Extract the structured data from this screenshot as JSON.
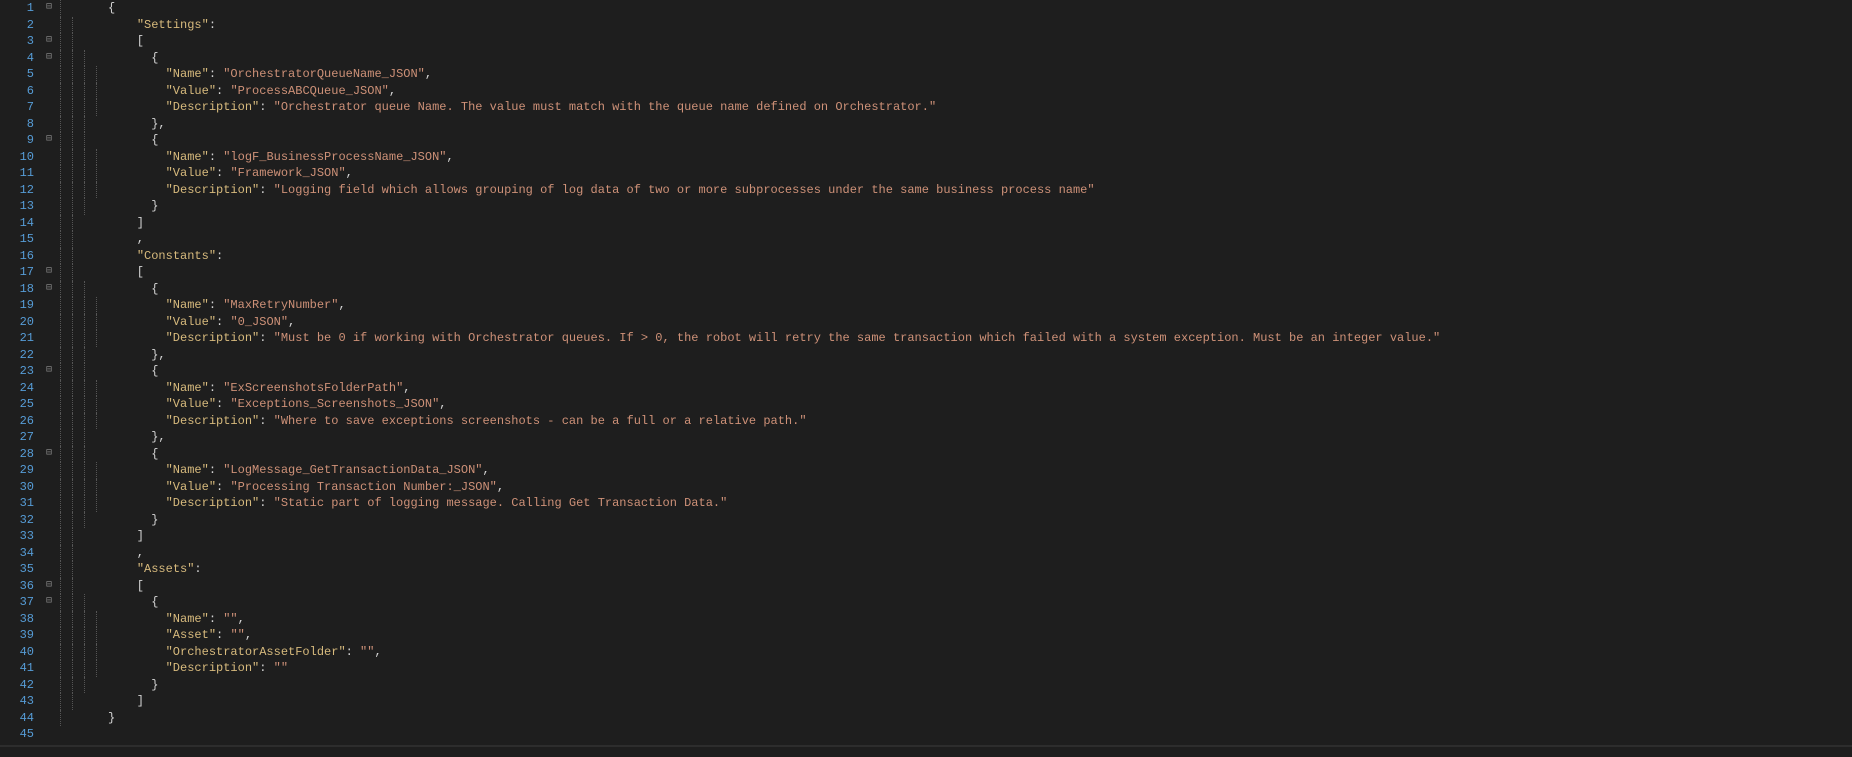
{
  "line_count": 45,
  "fold_markers": {
    "1": "⊟",
    "3": "⊟",
    "4": "⊟",
    "9": "⊟",
    "17": "⊟",
    "18": "⊟",
    "23": "⊟",
    "28": "⊟",
    "36": "⊟",
    "37": "⊟"
  },
  "indent_guides": {
    "1": [
      0
    ],
    "2": [
      0,
      1
    ],
    "3": [
      0,
      1
    ],
    "4": [
      0,
      1,
      2
    ],
    "5": [
      0,
      1,
      2,
      3
    ],
    "6": [
      0,
      1,
      2,
      3
    ],
    "7": [
      0,
      1,
      2,
      3
    ],
    "8": [
      0,
      1,
      2
    ],
    "9": [
      0,
      1,
      2
    ],
    "10": [
      0,
      1,
      2,
      3
    ],
    "11": [
      0,
      1,
      2,
      3
    ],
    "12": [
      0,
      1,
      2,
      3
    ],
    "13": [
      0,
      1,
      2
    ],
    "14": [
      0,
      1
    ],
    "15": [
      0,
      1
    ],
    "16": [
      0,
      1
    ],
    "17": [
      0,
      1
    ],
    "18": [
      0,
      1,
      2
    ],
    "19": [
      0,
      1,
      2,
      3
    ],
    "20": [
      0,
      1,
      2,
      3
    ],
    "21": [
      0,
      1,
      2,
      3
    ],
    "22": [
      0,
      1,
      2
    ],
    "23": [
      0,
      1,
      2
    ],
    "24": [
      0,
      1,
      2,
      3
    ],
    "25": [
      0,
      1,
      2,
      3
    ],
    "26": [
      0,
      1,
      2,
      3
    ],
    "27": [
      0,
      1,
      2
    ],
    "28": [
      0,
      1,
      2
    ],
    "29": [
      0,
      1,
      2,
      3
    ],
    "30": [
      0,
      1,
      2,
      3
    ],
    "31": [
      0,
      1,
      2,
      3
    ],
    "32": [
      0,
      1,
      2
    ],
    "33": [
      0,
      1
    ],
    "34": [
      0,
      1
    ],
    "35": [
      0,
      1
    ],
    "36": [
      0,
      1
    ],
    "37": [
      0,
      1,
      2
    ],
    "38": [
      0,
      1,
      2,
      3
    ],
    "39": [
      0,
      1,
      2,
      3
    ],
    "40": [
      0,
      1,
      2,
      3
    ],
    "41": [
      0,
      1,
      2,
      3
    ],
    "42": [
      0,
      1,
      2
    ],
    "43": [
      0,
      1
    ],
    "44": [
      0
    ]
  },
  "lines": [
    {
      "n": 1,
      "tokens": [
        {
          "t": "{",
          "c": "punct"
        }
      ]
    },
    {
      "n": 2,
      "tokens": [
        {
          "t": "    ",
          "c": "punct"
        },
        {
          "t": "\"Settings\"",
          "c": "key"
        },
        {
          "t": ":",
          "c": "punct"
        }
      ]
    },
    {
      "n": 3,
      "tokens": [
        {
          "t": "    [",
          "c": "punct"
        }
      ]
    },
    {
      "n": 4,
      "tokens": [
        {
          "t": "      {",
          "c": "punct"
        }
      ]
    },
    {
      "n": 5,
      "tokens": [
        {
          "t": "        ",
          "c": "punct"
        },
        {
          "t": "\"Name\"",
          "c": "key"
        },
        {
          "t": ": ",
          "c": "punct"
        },
        {
          "t": "\"OrchestratorQueueName_JSON\"",
          "c": "str"
        },
        {
          "t": ",",
          "c": "punct"
        }
      ]
    },
    {
      "n": 6,
      "tokens": [
        {
          "t": "        ",
          "c": "punct"
        },
        {
          "t": "\"Value\"",
          "c": "key"
        },
        {
          "t": ": ",
          "c": "punct"
        },
        {
          "t": "\"ProcessABCQueue_JSON\"",
          "c": "str"
        },
        {
          "t": ",",
          "c": "punct"
        }
      ]
    },
    {
      "n": 7,
      "tokens": [
        {
          "t": "        ",
          "c": "punct"
        },
        {
          "t": "\"Description\"",
          "c": "key"
        },
        {
          "t": ": ",
          "c": "punct"
        },
        {
          "t": "\"Orchestrator queue Name. The value must match with the queue name defined on Orchestrator.\"",
          "c": "str"
        }
      ]
    },
    {
      "n": 8,
      "tokens": [
        {
          "t": "      },",
          "c": "punct"
        }
      ]
    },
    {
      "n": 9,
      "tokens": [
        {
          "t": "      {",
          "c": "punct"
        }
      ]
    },
    {
      "n": 10,
      "tokens": [
        {
          "t": "        ",
          "c": "punct"
        },
        {
          "t": "\"Name\"",
          "c": "key"
        },
        {
          "t": ": ",
          "c": "punct"
        },
        {
          "t": "\"logF_BusinessProcessName_JSON\"",
          "c": "str"
        },
        {
          "t": ",",
          "c": "punct"
        }
      ]
    },
    {
      "n": 11,
      "tokens": [
        {
          "t": "        ",
          "c": "punct"
        },
        {
          "t": "\"Value\"",
          "c": "key"
        },
        {
          "t": ": ",
          "c": "punct"
        },
        {
          "t": "\"Framework_JSON\"",
          "c": "str"
        },
        {
          "t": ",",
          "c": "punct"
        }
      ]
    },
    {
      "n": 12,
      "tokens": [
        {
          "t": "        ",
          "c": "punct"
        },
        {
          "t": "\"Description\"",
          "c": "key"
        },
        {
          "t": ": ",
          "c": "punct"
        },
        {
          "t": "\"Logging field which allows grouping of log data of two or more subprocesses under the same business process name\"",
          "c": "str"
        }
      ]
    },
    {
      "n": 13,
      "tokens": [
        {
          "t": "      }",
          "c": "punct"
        }
      ]
    },
    {
      "n": 14,
      "tokens": [
        {
          "t": "    ]",
          "c": "punct"
        }
      ]
    },
    {
      "n": 15,
      "tokens": [
        {
          "t": "    ,",
          "c": "punct"
        }
      ]
    },
    {
      "n": 16,
      "tokens": [
        {
          "t": "    ",
          "c": "punct"
        },
        {
          "t": "\"Constants\"",
          "c": "key"
        },
        {
          "t": ":",
          "c": "punct"
        }
      ]
    },
    {
      "n": 17,
      "tokens": [
        {
          "t": "    [",
          "c": "punct"
        }
      ]
    },
    {
      "n": 18,
      "tokens": [
        {
          "t": "      {",
          "c": "punct"
        }
      ]
    },
    {
      "n": 19,
      "tokens": [
        {
          "t": "        ",
          "c": "punct"
        },
        {
          "t": "\"Name\"",
          "c": "key"
        },
        {
          "t": ": ",
          "c": "punct"
        },
        {
          "t": "\"MaxRetryNumber\"",
          "c": "str"
        },
        {
          "t": ",",
          "c": "punct"
        }
      ]
    },
    {
      "n": 20,
      "tokens": [
        {
          "t": "        ",
          "c": "punct"
        },
        {
          "t": "\"Value\"",
          "c": "key"
        },
        {
          "t": ": ",
          "c": "punct"
        },
        {
          "t": "\"0_JSON\"",
          "c": "str"
        },
        {
          "t": ",",
          "c": "punct"
        }
      ]
    },
    {
      "n": 21,
      "tokens": [
        {
          "t": "        ",
          "c": "punct"
        },
        {
          "t": "\"Description\"",
          "c": "key"
        },
        {
          "t": ": ",
          "c": "punct"
        },
        {
          "t": "\"Must be 0 if working with Orchestrator queues. If > 0, the robot will retry the same transaction which failed with a system exception. Must be an integer value.\"",
          "c": "str"
        }
      ]
    },
    {
      "n": 22,
      "tokens": [
        {
          "t": "      },",
          "c": "punct"
        }
      ]
    },
    {
      "n": 23,
      "tokens": [
        {
          "t": "      {",
          "c": "punct"
        }
      ]
    },
    {
      "n": 24,
      "tokens": [
        {
          "t": "        ",
          "c": "punct"
        },
        {
          "t": "\"Name\"",
          "c": "key"
        },
        {
          "t": ": ",
          "c": "punct"
        },
        {
          "t": "\"ExScreenshotsFolderPath\"",
          "c": "str"
        },
        {
          "t": ",",
          "c": "punct"
        }
      ]
    },
    {
      "n": 25,
      "tokens": [
        {
          "t": "        ",
          "c": "punct"
        },
        {
          "t": "\"Value\"",
          "c": "key"
        },
        {
          "t": ": ",
          "c": "punct"
        },
        {
          "t": "\"Exceptions_Screenshots_JSON\"",
          "c": "str"
        },
        {
          "t": ",",
          "c": "punct"
        }
      ]
    },
    {
      "n": 26,
      "tokens": [
        {
          "t": "        ",
          "c": "punct"
        },
        {
          "t": "\"Description\"",
          "c": "key"
        },
        {
          "t": ": ",
          "c": "punct"
        },
        {
          "t": "\"Where to save exceptions screenshots - can be a full or a relative path.\"",
          "c": "str"
        }
      ]
    },
    {
      "n": 27,
      "tokens": [
        {
          "t": "      },",
          "c": "punct"
        }
      ]
    },
    {
      "n": 28,
      "tokens": [
        {
          "t": "      {",
          "c": "punct"
        }
      ]
    },
    {
      "n": 29,
      "tokens": [
        {
          "t": "        ",
          "c": "punct"
        },
        {
          "t": "\"Name\"",
          "c": "key"
        },
        {
          "t": ": ",
          "c": "punct"
        },
        {
          "t": "\"LogMessage_GetTransactionData_JSON\"",
          "c": "str"
        },
        {
          "t": ",",
          "c": "punct"
        }
      ]
    },
    {
      "n": 30,
      "tokens": [
        {
          "t": "        ",
          "c": "punct"
        },
        {
          "t": "\"Value\"",
          "c": "key"
        },
        {
          "t": ": ",
          "c": "punct"
        },
        {
          "t": "\"Processing Transaction Number:_JSON\"",
          "c": "str"
        },
        {
          "t": ",",
          "c": "punct"
        }
      ]
    },
    {
      "n": 31,
      "tokens": [
        {
          "t": "        ",
          "c": "punct"
        },
        {
          "t": "\"Description\"",
          "c": "key"
        },
        {
          "t": ": ",
          "c": "punct"
        },
        {
          "t": "\"Static part of logging message. Calling Get Transaction Data.\"",
          "c": "str"
        }
      ]
    },
    {
      "n": 32,
      "tokens": [
        {
          "t": "      }",
          "c": "punct"
        }
      ]
    },
    {
      "n": 33,
      "tokens": [
        {
          "t": "    ]",
          "c": "punct"
        }
      ]
    },
    {
      "n": 34,
      "tokens": [
        {
          "t": "    ,",
          "c": "punct"
        }
      ]
    },
    {
      "n": 35,
      "tokens": [
        {
          "t": "    ",
          "c": "punct"
        },
        {
          "t": "\"Assets\"",
          "c": "key"
        },
        {
          "t": ":",
          "c": "punct"
        }
      ]
    },
    {
      "n": 36,
      "tokens": [
        {
          "t": "    [",
          "c": "punct"
        }
      ]
    },
    {
      "n": 37,
      "tokens": [
        {
          "t": "      {",
          "c": "punct"
        }
      ]
    },
    {
      "n": 38,
      "tokens": [
        {
          "t": "        ",
          "c": "punct"
        },
        {
          "t": "\"Name\"",
          "c": "key"
        },
        {
          "t": ": ",
          "c": "punct"
        },
        {
          "t": "\"\"",
          "c": "str"
        },
        {
          "t": ",",
          "c": "punct"
        }
      ]
    },
    {
      "n": 39,
      "tokens": [
        {
          "t": "        ",
          "c": "punct"
        },
        {
          "t": "\"Asset\"",
          "c": "key"
        },
        {
          "t": ": ",
          "c": "punct"
        },
        {
          "t": "\"\"",
          "c": "str"
        },
        {
          "t": ",",
          "c": "punct"
        }
      ]
    },
    {
      "n": 40,
      "tokens": [
        {
          "t": "        ",
          "c": "punct"
        },
        {
          "t": "\"OrchestratorAssetFolder\"",
          "c": "key"
        },
        {
          "t": ": ",
          "c": "punct"
        },
        {
          "t": "\"\"",
          "c": "str"
        },
        {
          "t": ",",
          "c": "punct"
        }
      ]
    },
    {
      "n": 41,
      "tokens": [
        {
          "t": "        ",
          "c": "punct"
        },
        {
          "t": "\"Description\"",
          "c": "key"
        },
        {
          "t": ": ",
          "c": "punct"
        },
        {
          "t": "\"\"",
          "c": "str"
        }
      ]
    },
    {
      "n": 42,
      "tokens": [
        {
          "t": "      }",
          "c": "punct"
        }
      ]
    },
    {
      "n": 43,
      "tokens": [
        {
          "t": "    ]",
          "c": "punct"
        }
      ]
    },
    {
      "n": 44,
      "tokens": [
        {
          "t": "}",
          "c": "punct"
        }
      ]
    },
    {
      "n": 45,
      "tokens": []
    }
  ]
}
